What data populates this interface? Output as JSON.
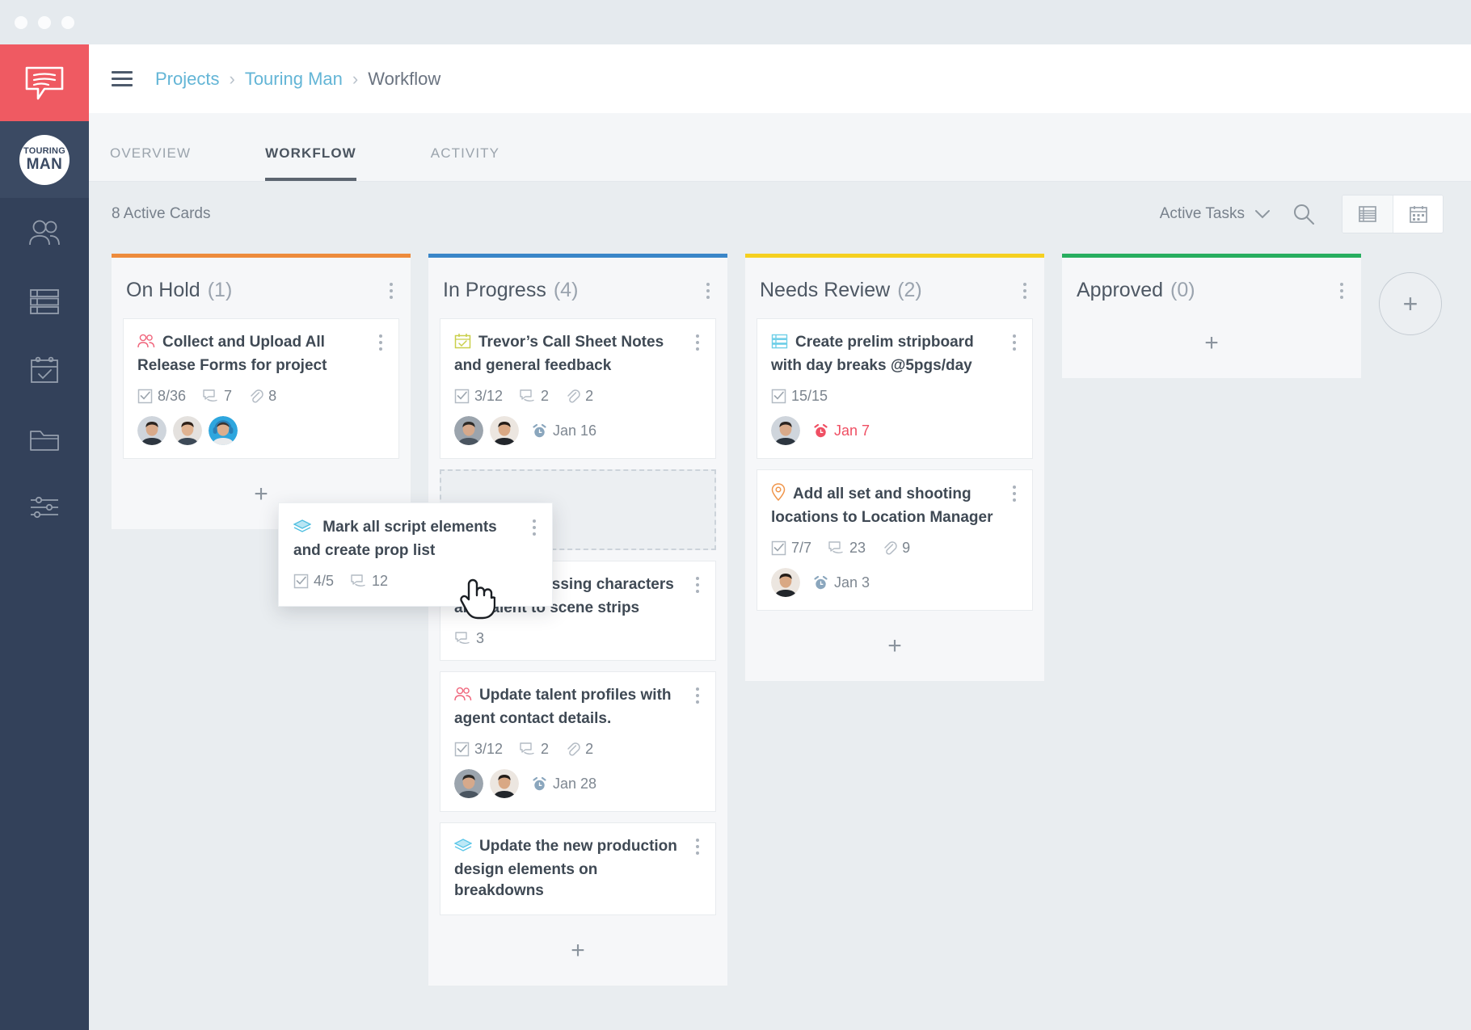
{
  "window": {
    "dots": [
      "close",
      "minimize",
      "maximize"
    ]
  },
  "rail": {
    "logo_icon": "speech-bubble-logo-icon",
    "project_avatar": {
      "line1": "TOURING",
      "line2": "MAN"
    },
    "items": [
      {
        "name": "contacts",
        "icon": "people-icon"
      },
      {
        "name": "stripboard",
        "icon": "rows-list-icon"
      },
      {
        "name": "schedule",
        "icon": "calendar-check-icon"
      },
      {
        "name": "files",
        "icon": "folder-icon"
      },
      {
        "name": "settings",
        "icon": "sliders-icon"
      }
    ]
  },
  "topbar": {
    "menu_icon": "hamburger-icon",
    "breadcrumb": [
      {
        "label": "Projects",
        "type": "link"
      },
      {
        "label": "Touring Man",
        "type": "link"
      },
      {
        "label": "Workflow",
        "type": "current"
      }
    ],
    "separator": "›"
  },
  "tabs": [
    {
      "label": "OVERVIEW",
      "active": false
    },
    {
      "label": "WORKFLOW",
      "active": true
    },
    {
      "label": "ACTIVITY",
      "active": false
    }
  ],
  "board_toolbar": {
    "active_cards": "8 Active Cards",
    "filter_label": "Active Tasks",
    "chevron_icon": "chevron-down-icon",
    "search_icon": "search-icon",
    "views": [
      {
        "name": "list-view",
        "icon": "list-view-icon",
        "active": false
      },
      {
        "name": "calendar-view",
        "icon": "calendar-view-icon",
        "active": true
      }
    ]
  },
  "add_column_label": "+",
  "columns": [
    {
      "title": "On Hold",
      "count": "(1)",
      "accent": "#ED8B3C",
      "add_label": "+",
      "cards": [
        {
          "icon": "talent-people-icon",
          "icon_color": "#F0647B",
          "title": "Collect and Upload All Release Forms for project",
          "checklist": "8/36",
          "comments": "7",
          "attachments": "8",
          "avatars": [
            "man-dark-hair",
            "woman-dark-hair",
            "man-headphones"
          ],
          "due": null
        }
      ]
    },
    {
      "title": "In Progress",
      "count": "(4)",
      "accent": "#3A86C8",
      "add_label": "+",
      "has_drop_placeholder": true,
      "cards": [
        {
          "icon": "calendar-check-icon",
          "icon_color": "#C9CF4A",
          "title": "Trevor’s Call Sheet Notes and general feedback",
          "checklist": "3/12",
          "comments": "2",
          "attachments": "2",
          "avatars": [
            "man-grey-bg",
            "man-beige-bg"
          ],
          "due": "Jan 16",
          "due_overdue": false
        },
        {
          "icon": "stripboard-icon",
          "icon_color": "#7FD4EE",
          "title": "Add all missing characters and talent to scene strips",
          "checklist": null,
          "comments": "3",
          "attachments": null,
          "avatars": [],
          "due": null
        },
        {
          "icon": "talent-people-icon",
          "icon_color": "#F0647B",
          "title": "Update talent profiles with agent contact details.",
          "checklist": "3/12",
          "comments": "2",
          "attachments": "2",
          "avatars": [
            "man-grey-bg",
            "man-beige-bg"
          ],
          "due": "Jan 28",
          "due_overdue": false
        },
        {
          "icon": "layers-icon",
          "icon_color": "#5BC6E8",
          "title": "Update the new production design elements on breakdowns",
          "checklist": null,
          "comments": null,
          "attachments": null,
          "avatars": [],
          "due": null
        }
      ]
    },
    {
      "title": "Needs Review",
      "count": "(2)",
      "accent": "#F5D020",
      "add_label": "+",
      "cards": [
        {
          "icon": "stripboard-icon",
          "icon_color": "#6FCFE8",
          "title": "Create prelim stripboard with day breaks @5pgs/day",
          "checklist": "15/15",
          "comments": null,
          "attachments": null,
          "avatars": [
            "man-dark-hair"
          ],
          "due": "Jan 7",
          "due_overdue": true
        },
        {
          "icon": "location-pin-icon",
          "icon_color": "#F0954A",
          "title": "Add all set and shooting locations to Location Manager",
          "checklist": "7/7",
          "comments": "23",
          "attachments": "9",
          "avatars": [
            "man-beige-bg"
          ],
          "due": "Jan 3",
          "due_overdue": false
        }
      ]
    },
    {
      "title": "Approved",
      "count": "(0)",
      "accent": "#27AE5F",
      "add_label": "+",
      "cards": []
    }
  ],
  "drag_card": {
    "icon": "layers-icon",
    "icon_color": "#5BC6E8",
    "title": "Mark all script elements and create prop list",
    "checklist": "4/5",
    "comments": "12",
    "cursor_icon": "pointing-hand-cursor-icon"
  }
}
